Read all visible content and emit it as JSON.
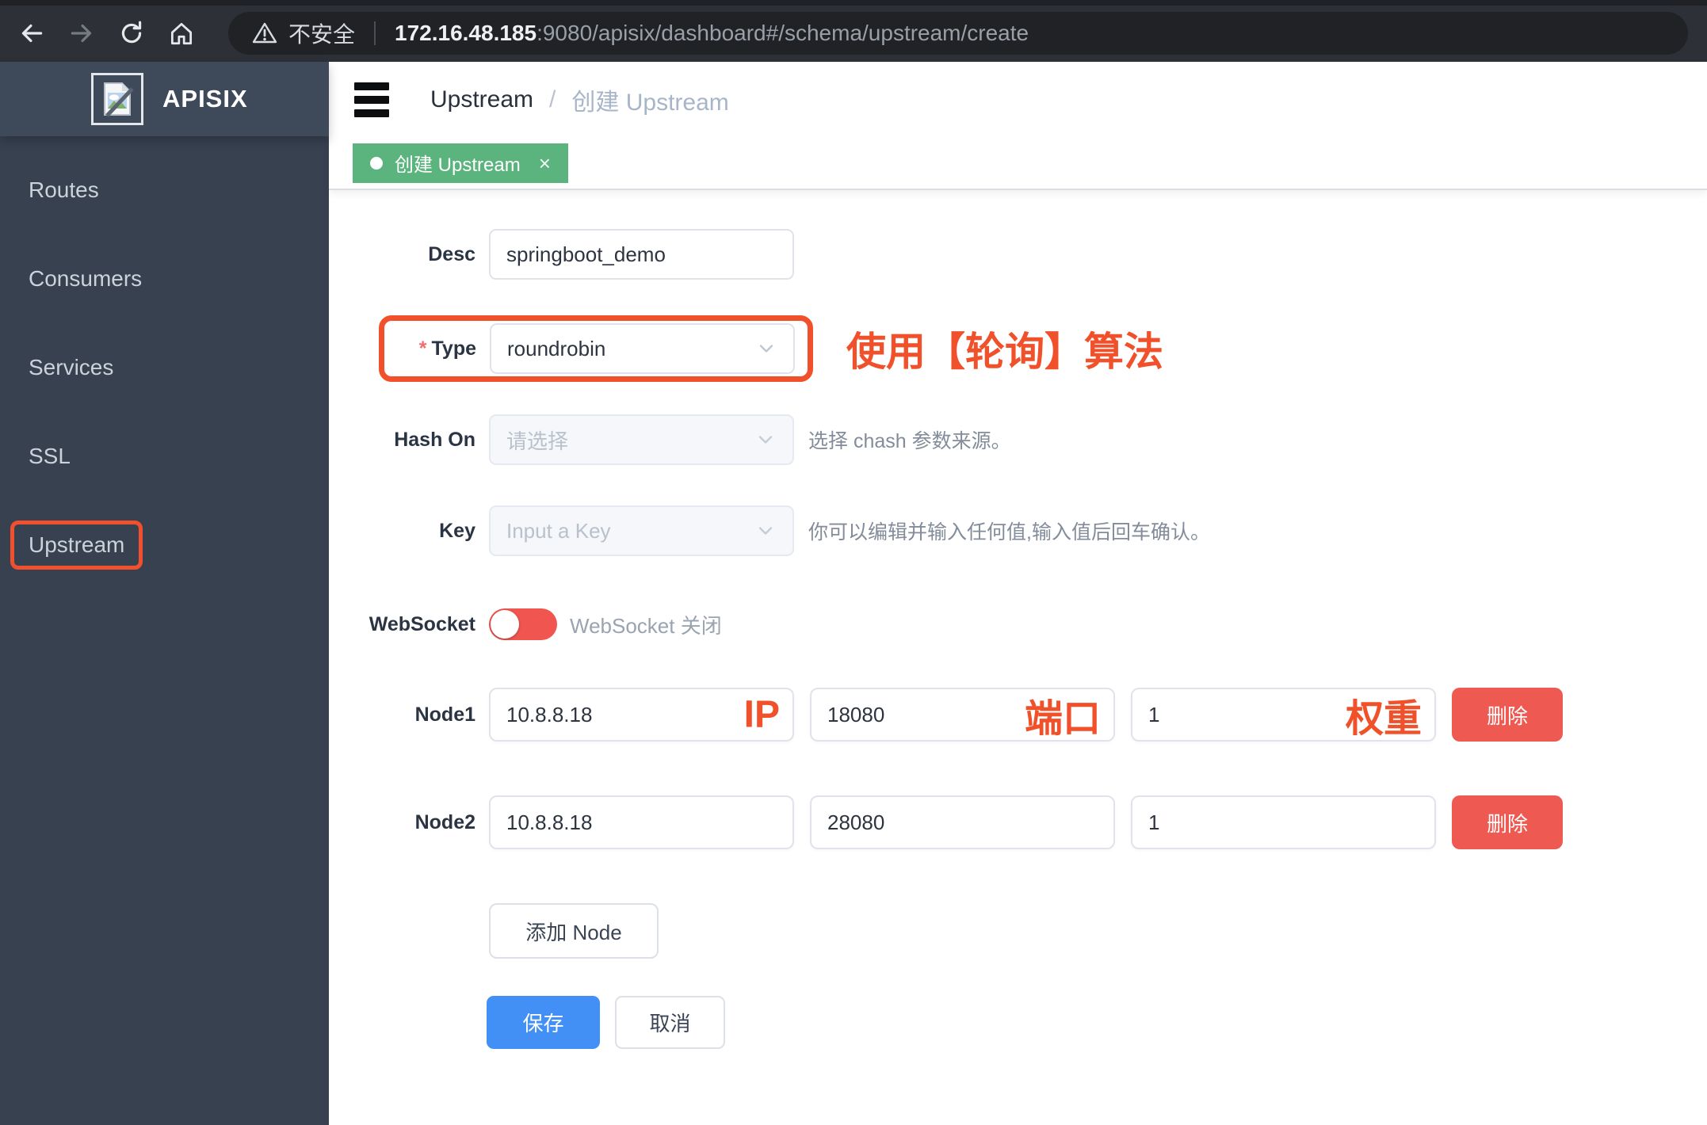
{
  "browser": {
    "security_label": "不安全",
    "url_host": "172.16.48.185",
    "url_path": ":9080/apisix/dashboard#/schema/upstream/create"
  },
  "sidebar": {
    "brand": "APISIX",
    "items": [
      {
        "label": "Routes"
      },
      {
        "label": "Consumers"
      },
      {
        "label": "Services"
      },
      {
        "label": "SSL"
      },
      {
        "label": "Upstream"
      }
    ]
  },
  "breadcrumb": {
    "parent": "Upstream",
    "separator": "/",
    "current": "创建 Upstream"
  },
  "tab": {
    "label": "创建 Upstream",
    "close": "×"
  },
  "form": {
    "desc": {
      "label": "Desc",
      "value": "springboot_demo"
    },
    "type": {
      "required_mark": "*",
      "label": "Type",
      "value": "roundrobin",
      "annotation": "使用【轮询】算法"
    },
    "hash_on": {
      "label": "Hash On",
      "placeholder": "请选择",
      "hint": "选择 chash 参数来源。"
    },
    "key": {
      "label": "Key",
      "placeholder": "Input a Key",
      "hint": "你可以编辑并输入任何值,输入值后回车确认。"
    },
    "websocket": {
      "label": "WebSocket",
      "status": "WebSocket 关闭"
    },
    "nodes": [
      {
        "label": "Node1",
        "ip": "10.8.8.18",
        "port": "18080",
        "weight": "1",
        "annotations": {
          "ip": "IP",
          "port": "端口",
          "weight": "权重"
        },
        "delete_label": "删除"
      },
      {
        "label": "Node2",
        "ip": "10.8.8.18",
        "port": "28080",
        "weight": "1",
        "delete_label": "删除"
      }
    ],
    "add_node_label": "添加 Node",
    "save_label": "保存",
    "cancel_label": "取消"
  },
  "colors": {
    "annotation_orange": "#f0512b",
    "tab_green": "#5bb47e",
    "primary_blue": "#4290f5",
    "danger_red": "#ee5a52",
    "sidebar_bg": "#374150",
    "toolbar_bg": "#2d3036"
  }
}
